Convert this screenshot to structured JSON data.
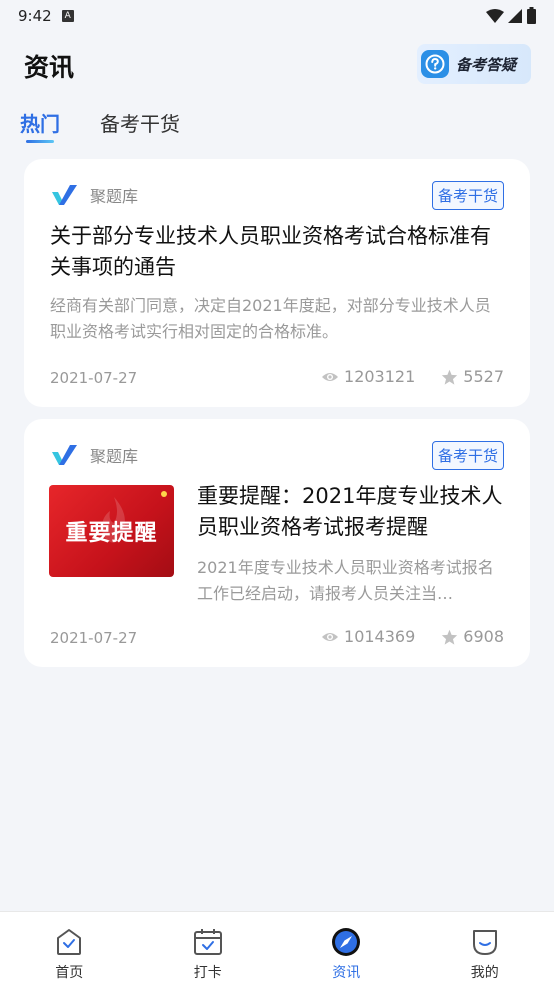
{
  "status_bar": {
    "time": "9:42",
    "notification": "A"
  },
  "header": {
    "title": "资讯",
    "qa_button_label": "备考答疑"
  },
  "tabs": [
    {
      "label": "热门",
      "active": true
    },
    {
      "label": "备考干货",
      "active": false
    }
  ],
  "articles": [
    {
      "source": "聚题库",
      "tag": "备考干货",
      "title": "关于部分专业技术人员职业资格考试合格标准有关事项的通告",
      "summary": "经商有关部门同意，决定自2021年度起，对部分专业技术人员职业资格考试实行相对固定的合格标准。",
      "date": "2021-07-27",
      "views": "1203121",
      "stars": "5527"
    },
    {
      "source": "聚题库",
      "tag": "备考干货",
      "thumbnail_text": "重要提醒",
      "title": "重要提醒：2021年度专业技术人员职业资格考试报考提醒",
      "summary": "2021年度专业技术人员职业资格考试报名工作已经启动，请报考人员关注当…",
      "date": "2021-07-27",
      "views": "1014369",
      "stars": "6908"
    }
  ],
  "bottom_nav": [
    {
      "label": "首页",
      "icon": "home-icon",
      "active": false
    },
    {
      "label": "打卡",
      "icon": "calendar-check-icon",
      "active": false
    },
    {
      "label": "资讯",
      "icon": "compass-icon",
      "active": true
    },
    {
      "label": "我的",
      "icon": "profile-icon",
      "active": false
    }
  ],
  "colors": {
    "accent": "#2f6fe4",
    "background": "#f3f5f9"
  }
}
